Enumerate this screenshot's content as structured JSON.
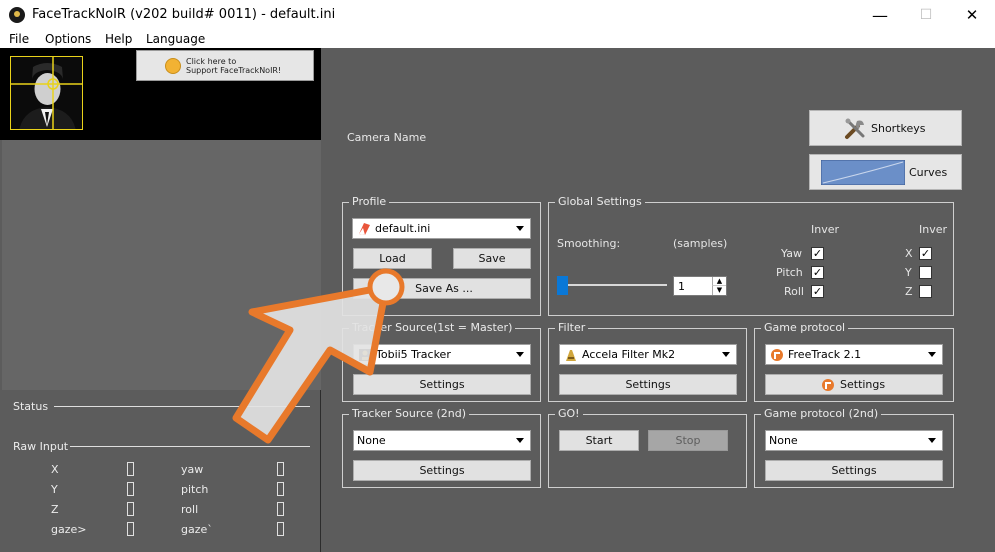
{
  "window": {
    "title": "FaceTrackNoIR (v202 build# 0011) - default.ini",
    "minimize": "—",
    "maximize": "☐",
    "close": "✕"
  },
  "menu": [
    "File",
    "Options",
    "Help",
    "Language"
  ],
  "support_button": {
    "text": "Click here to\nSupport FaceTrackNoIR!"
  },
  "camera": {
    "label": "Camera Name"
  },
  "shortkeys_label": "Shortkeys",
  "curves_label": "Curves",
  "profile": {
    "title": "Profile",
    "selected": "default.ini",
    "load": "Load",
    "save": "Save",
    "save_as": "Save As ..."
  },
  "global_settings": {
    "title": "Global Settings",
    "smoothing_label": "Smoothing:",
    "samples_label": "(samples)",
    "smoothing_value": "1",
    "invert_left_header": "Inver",
    "invert_right_header": "Inver",
    "rotation_axes": [
      {
        "label": "Yaw",
        "checked": true
      },
      {
        "label": "Pitch",
        "checked": true
      },
      {
        "label": "Roll",
        "checked": true
      }
    ],
    "translation_axes": [
      {
        "label": "X",
        "checked": true
      },
      {
        "label": "Y",
        "checked": false
      },
      {
        "label": "Z",
        "checked": false
      }
    ]
  },
  "tracker_source": {
    "title": "Tracker Source(1st = Master)",
    "selected": "Tobii5 Tracker",
    "settings": "Settings"
  },
  "filter": {
    "title": "Filter",
    "selected": "Accela Filter Mk2",
    "settings": "Settings"
  },
  "game_protocol": {
    "title": "Game protocol",
    "selected": "FreeTrack 2.1",
    "settings": "Settings"
  },
  "tracker_source_2nd": {
    "title": "Tracker Source (2nd)",
    "selected": "None",
    "settings": "Settings"
  },
  "go": {
    "title": "GO!",
    "start": "Start",
    "stop": "Stop"
  },
  "game_protocol_2nd": {
    "title": "Game protocol (2nd)",
    "selected": "None",
    "settings": "Settings"
  },
  "status": {
    "label": "Status"
  },
  "raw_input": {
    "label": "Raw Input",
    "left": [
      "X",
      "Y",
      "Z",
      "gaze>"
    ],
    "right": [
      "yaw",
      "pitch",
      "roll",
      "gaze`"
    ]
  },
  "colors": {
    "background": "#5c5c5c",
    "video_frame": "#e9d21a",
    "pointer_orange": "#e8792b",
    "slider_blue": "#0a78d7"
  }
}
